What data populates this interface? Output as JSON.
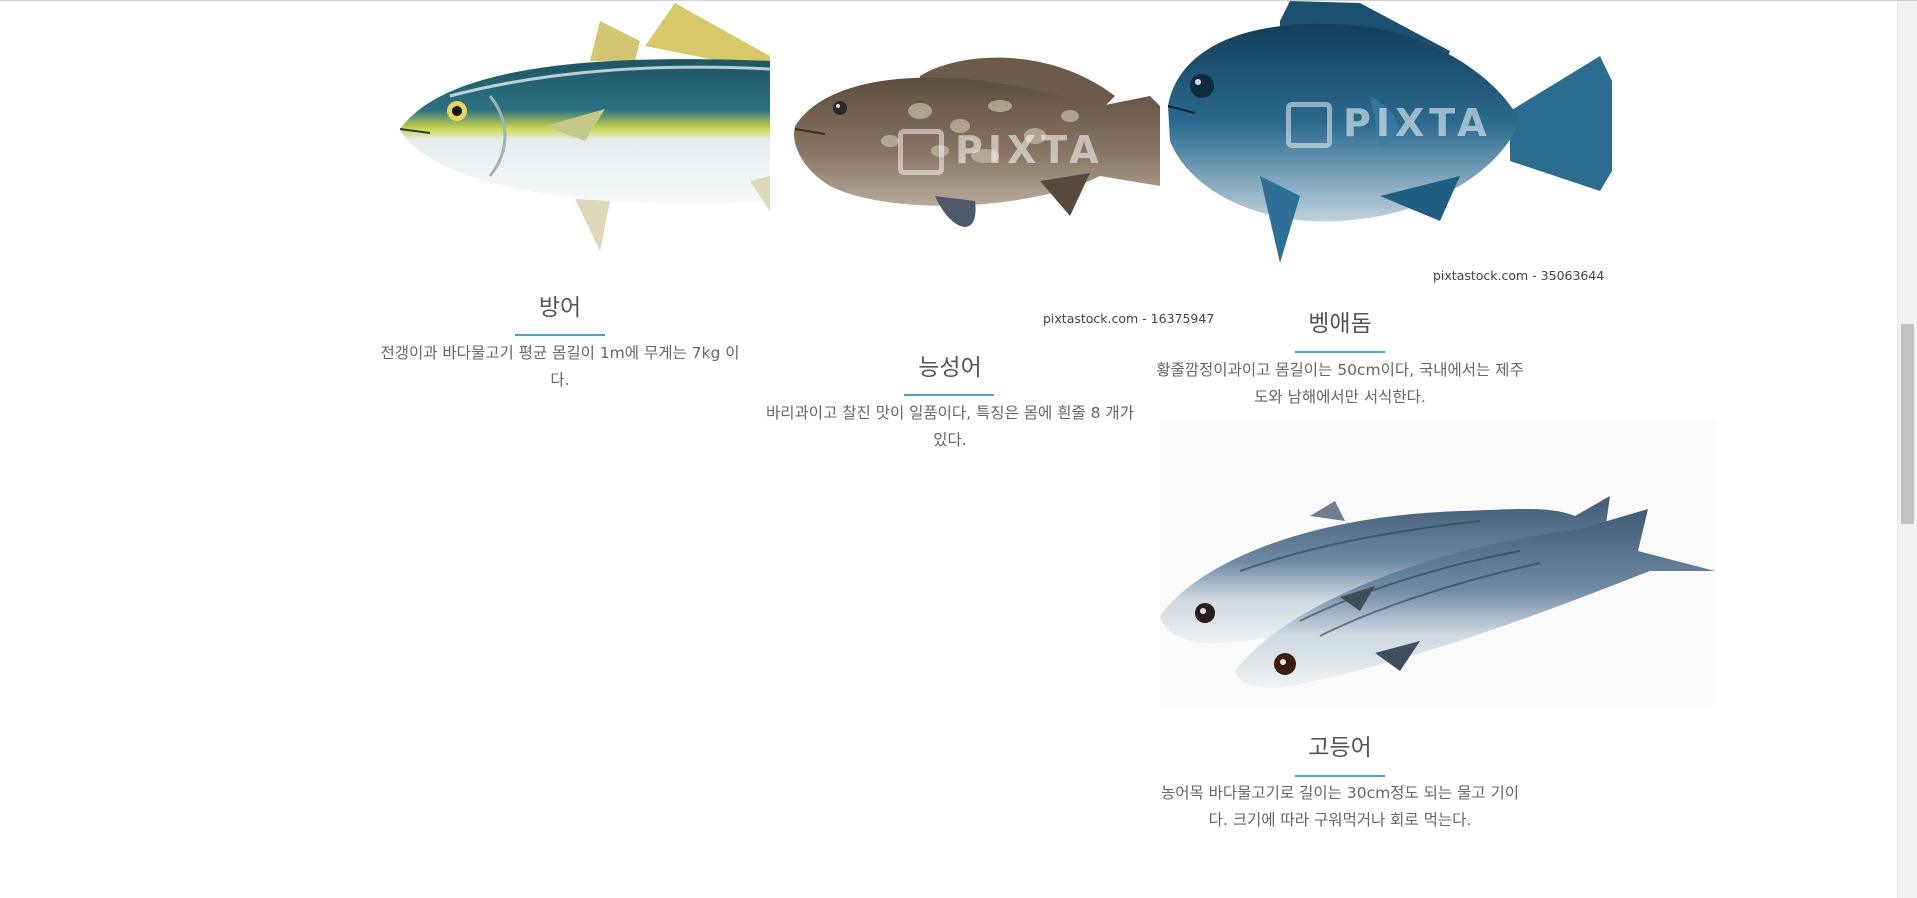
{
  "fish": [
    {
      "name": "방어",
      "description": "전갱이과 바다물고기 평균 몸길이 1m에 무게는 7kg 이다."
    },
    {
      "name": "능성어",
      "description": "바리과이고 찰진 맛이 일품이다, 특징은 몸에 흰줄 8 개가 있다.",
      "watermark": "PIXTA",
      "credit": "pixtastock.com - 16375947"
    },
    {
      "name": "벵애돔",
      "description": "황줄깜정이과이고 몸길이는 50cm이다, 국내에서는 제주도와 남해에서만 서식한다.",
      "watermark": "PIXTA",
      "credit": "pixtastock.com - 35063644"
    },
    {
      "name": "고등어",
      "description": "농어목 바다물고기로 길이는 30cm정도 되는 물고 기이다. 크기에 따라 구워먹거나 회로 먹는다."
    }
  ]
}
